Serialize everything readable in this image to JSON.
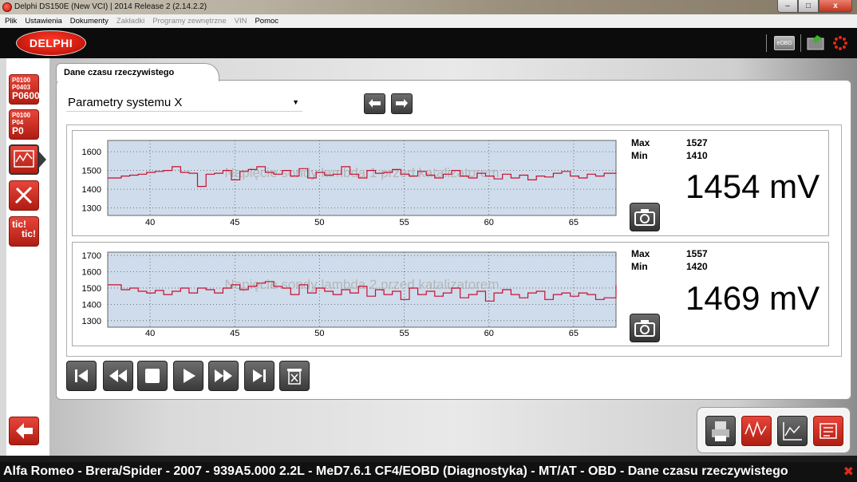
{
  "window": {
    "title": "Delphi DS150E (New VCI) | 2014 Release 2 (2.14.2.2)",
    "controls": {
      "minimize": "–",
      "maximize": "□",
      "close": "x"
    }
  },
  "menu": [
    {
      "label": "Plik",
      "disabled": false
    },
    {
      "label": "Ustawienia",
      "disabled": false
    },
    {
      "label": "Dokumenty",
      "disabled": false
    },
    {
      "label": "Zakładki",
      "disabled": true
    },
    {
      "label": "Programy zewnętrzne",
      "disabled": true
    },
    {
      "label": "VIN",
      "disabled": true
    },
    {
      "label": "Pomoc",
      "disabled": false
    }
  ],
  "header": {
    "logo": "DELPHI",
    "obd_label": "eOBD"
  },
  "sidebar": {
    "codes_button_lines": [
      "P0100",
      "P0403",
      "P0600"
    ],
    "erase_button_lines": [
      "P0100",
      "P04",
      "P0"
    ],
    "tic_lines": [
      "tic!",
      "tic!"
    ]
  },
  "tab": {
    "label": "Dane czasu rzeczywistego"
  },
  "param_select": {
    "value": "Parametry systemu X"
  },
  "colors": {
    "plot_bg": "#cfdcec",
    "line": "#c8102e",
    "accent_red": "#d22a1e"
  },
  "stats": [
    {
      "max_label": "Max",
      "min_label": "Min",
      "max": "1527",
      "min": "1410",
      "value": "1454",
      "unit": "mV"
    },
    {
      "max_label": "Max",
      "min_label": "Min",
      "max": "1557",
      "min": "1420",
      "value": "1469",
      "unit": "mV"
    }
  ],
  "chart_data": [
    {
      "type": "line",
      "title": "Napięcie sondy lambda 1 przed katalizatorem",
      "x_ticks": [
        40,
        45,
        50,
        55,
        60,
        65
      ],
      "y_ticks": [
        1300,
        1400,
        1500,
        1600
      ],
      "xlim": [
        37.5,
        67.5
      ],
      "ylim": [
        1260,
        1660
      ],
      "grid": true,
      "series": [
        {
          "x": [
            37.5,
            38.3,
            38.8,
            39.3,
            39.8,
            40.3,
            40.8,
            41.3,
            41.8,
            42.3,
            42.8,
            43.3,
            43.8,
            44.3,
            44.8,
            45.3,
            45.8,
            46.3,
            46.8,
            47.3,
            47.8,
            48.3,
            48.8,
            49.3,
            49.8,
            50.3,
            50.8,
            51.3,
            51.8,
            52.3,
            52.8,
            53.3,
            53.8,
            54.3,
            54.8,
            55.3,
            55.8,
            56.3,
            56.8,
            57.3,
            57.8,
            58.3,
            58.8,
            59.3,
            59.8,
            60.3,
            60.8,
            61.3,
            61.8,
            62.3,
            62.8,
            63.3,
            63.8,
            64.3,
            64.8,
            65.3,
            65.8,
            66.3,
            66.8,
            67.5
          ],
          "y": [
            1460,
            1470,
            1475,
            1480,
            1490,
            1495,
            1500,
            1520,
            1490,
            1485,
            1415,
            1480,
            1485,
            1500,
            1450,
            1495,
            1505,
            1520,
            1490,
            1480,
            1500,
            1470,
            1510,
            1460,
            1490,
            1475,
            1480,
            1520,
            1480,
            1460,
            1500,
            1485,
            1490,
            1505,
            1480,
            1470,
            1495,
            1475,
            1460,
            1480,
            1500,
            1470,
            1460,
            1485,
            1470,
            1455,
            1480,
            1460,
            1475,
            1450,
            1470,
            1465,
            1485,
            1495,
            1470,
            1460,
            1480,
            1470,
            1485,
            1490
          ]
        }
      ]
    },
    {
      "type": "line",
      "title": "Napięcie sondy lambda 2 przed katalizatorem",
      "x_ticks": [
        40,
        45,
        50,
        55,
        60,
        65
      ],
      "y_ticks": [
        1300,
        1400,
        1500,
        1600,
        1700
      ],
      "xlim": [
        37.5,
        67.5
      ],
      "ylim": [
        1260,
        1720
      ],
      "grid": true,
      "series": [
        {
          "x": [
            37.5,
            38.3,
            38.8,
            39.3,
            39.8,
            40.3,
            40.8,
            41.3,
            41.8,
            42.3,
            42.8,
            43.3,
            43.8,
            44.3,
            44.8,
            45.3,
            45.8,
            46.3,
            46.8,
            47.3,
            47.8,
            48.3,
            48.8,
            49.3,
            49.8,
            50.3,
            50.8,
            51.3,
            51.8,
            52.3,
            52.8,
            53.3,
            53.8,
            54.3,
            54.8,
            55.3,
            55.8,
            56.3,
            56.8,
            57.3,
            57.8,
            58.3,
            58.8,
            59.3,
            59.8,
            60.3,
            60.8,
            61.3,
            61.8,
            62.3,
            62.8,
            63.3,
            63.8,
            64.3,
            64.8,
            65.3,
            65.8,
            66.3,
            66.8,
            67.5
          ],
          "y": [
            1520,
            1490,
            1500,
            1480,
            1470,
            1485,
            1460,
            1480,
            1500,
            1470,
            1500,
            1490,
            1470,
            1500,
            1520,
            1490,
            1510,
            1530,
            1540,
            1510,
            1500,
            1460,
            1520,
            1470,
            1500,
            1480,
            1460,
            1490,
            1470,
            1510,
            1450,
            1490,
            1460,
            1480,
            1430,
            1500,
            1460,
            1480,
            1450,
            1470,
            1500,
            1440,
            1460,
            1480,
            1420,
            1470,
            1490,
            1460,
            1440,
            1470,
            1480,
            1430,
            1460,
            1470,
            1450,
            1470,
            1460,
            1430,
            1440,
            1520
          ]
        }
      ]
    }
  ],
  "statusbar": {
    "text": "Alfa Romeo - Brera/Spider - 2007 - 939A5.000 2.2L - MeD7.6.1 CF4/EOBD (Diagnostyka) - MT/AT - OBD - Dane czasu rzeczywistego",
    "close": "✖"
  }
}
